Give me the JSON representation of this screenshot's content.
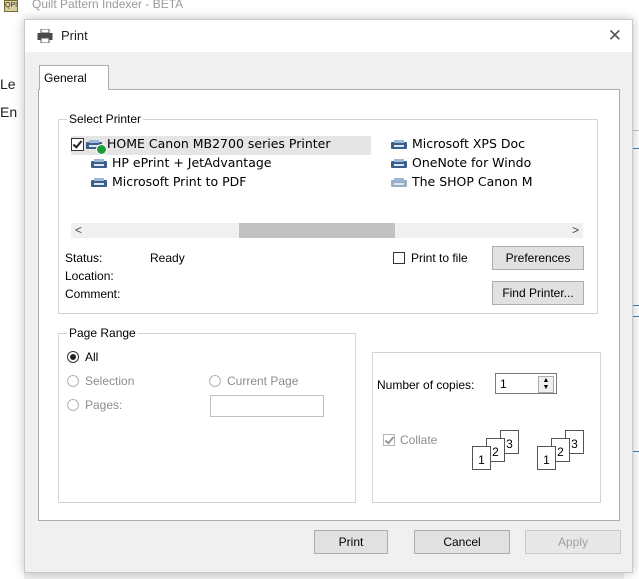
{
  "background_app": {
    "title": "Quilt Pattern Indexer - BETA",
    "menu_letter_1": "Le",
    "menu_letter_2": "En"
  },
  "dialog": {
    "title": "Print",
    "close_icon": "close-icon",
    "tab_general": "General",
    "select_printer": {
      "label": "Select Printer",
      "printers": [
        {
          "name": "HOME Canon MB2700 series Printer",
          "selected": true,
          "default": true
        },
        {
          "name": "HP ePrint + JetAdvantage"
        },
        {
          "name": "Microsoft Print to PDF"
        },
        {
          "name": "Microsoft XPS Doc"
        },
        {
          "name": "OneNote for Windo"
        },
        {
          "name": "The SHOP Canon M"
        }
      ],
      "scroll_left": "<",
      "scroll_right": ">",
      "status_label": "Status:",
      "status_value": "Ready",
      "location_label": "Location:",
      "comment_label": "Comment:",
      "print_to_file_label": "Print to file",
      "preferences_button": "Preferences",
      "find_printer_button": "Find Printer..."
    },
    "page_range": {
      "label": "Page Range",
      "all": "All",
      "selection": "Selection",
      "current_page": "Current Page",
      "pages": "Pages:"
    },
    "copies": {
      "label": "Number of copies:",
      "value": "1",
      "collate_label": "Collate",
      "collate_pages_1": [
        "1",
        "2",
        "3"
      ],
      "collate_pages_2": [
        "1",
        "2",
        "3"
      ]
    },
    "buttons": {
      "print": "Print",
      "cancel": "Cancel",
      "apply": "Apply"
    }
  }
}
